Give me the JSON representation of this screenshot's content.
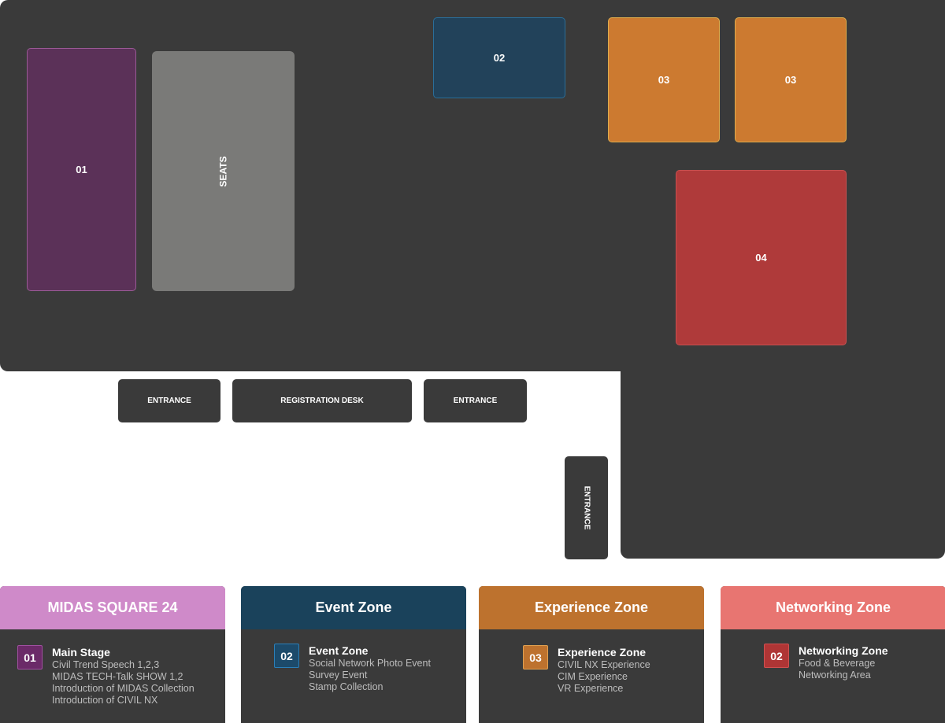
{
  "map": {
    "zones": {
      "z01": "01",
      "seats": "SEATS",
      "z02": "02",
      "z03a": "03",
      "z03b": "03",
      "z04": "04"
    },
    "doors": {
      "entrance_left": "ENTRANCE",
      "registration": "REGISTRATION DESK",
      "entrance_mid": "ENTRANCE",
      "entrance_side": "ENTRANCE"
    }
  },
  "legend": [
    {
      "header": "MIDAS SQUARE 24",
      "color": "#cf8ac9",
      "badge": "01",
      "title": "Main Stage",
      "lines": [
        "Civil Trend Speech 1,2,3",
        "MIDAS TECH-Talk SHOW 1,2",
        "Introduction of MIDAS Collection",
        "Introduction of CIVIL NX"
      ]
    },
    {
      "header": "Event Zone",
      "color": "#1a425b",
      "badge": "02",
      "title": "Event Zone",
      "lines": [
        "Social Network Photo Event",
        "Survey Event",
        "Stamp Collection"
      ]
    },
    {
      "header": "Experience Zone",
      "color": "#bd722e",
      "badge": "03",
      "title": "Experience Zone",
      "lines": [
        "CIVIL NX Experience",
        "CIM Experience",
        "VR Experience"
      ]
    },
    {
      "header": "Networking Zone",
      "color": "#e87571",
      "badge": "02",
      "title": "Networking Zone",
      "lines": [
        "Food & Beverage",
        "Networking Area"
      ]
    }
  ]
}
